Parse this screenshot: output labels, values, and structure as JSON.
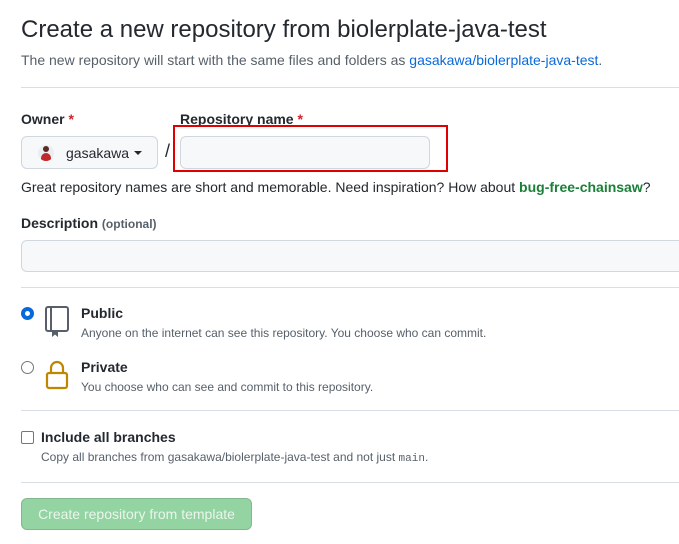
{
  "header": {
    "title": "Create a new repository from biolerplate-java-test",
    "subtitle_prefix": "The new repository will start with the same files and folders as ",
    "subtitle_link": "gasakawa/biolerplate-java-test",
    "subtitle_suffix": "."
  },
  "owner": {
    "label": "Owner",
    "required_mark": "*",
    "selected": "gasakawa"
  },
  "repo_name": {
    "label": "Repository name",
    "required_mark": "*",
    "value": "",
    "separator": "/",
    "highlight_color": "#e00000"
  },
  "hint": {
    "text": "Great repository names are short and memorable. Need inspiration? How about ",
    "suggestion": "bug-free-chainsaw",
    "suffix": "?"
  },
  "description": {
    "label": "Description",
    "optional": "(optional)",
    "value": ""
  },
  "visibility": {
    "public": {
      "title": "Public",
      "desc": "Anyone on the internet can see this repository. You choose who can commit.",
      "checked": true,
      "icon": "repo-icon"
    },
    "private": {
      "title": "Private",
      "desc": "You choose who can see and commit to this repository.",
      "checked": false,
      "icon": "lock-icon"
    }
  },
  "branches": {
    "label": "Include all branches",
    "desc_prefix": "Copy all branches from gasakawa/biolerplate-java-test and not just ",
    "desc_code": "main",
    "desc_suffix": ".",
    "checked": false
  },
  "submit": {
    "label": "Create repository from template",
    "disabled": true
  },
  "colors": {
    "link": "#0969da",
    "success": "#1a7f37",
    "danger": "#cf222e",
    "button_disabled": "#94d3a2",
    "lock_icon": "#bf8700"
  }
}
